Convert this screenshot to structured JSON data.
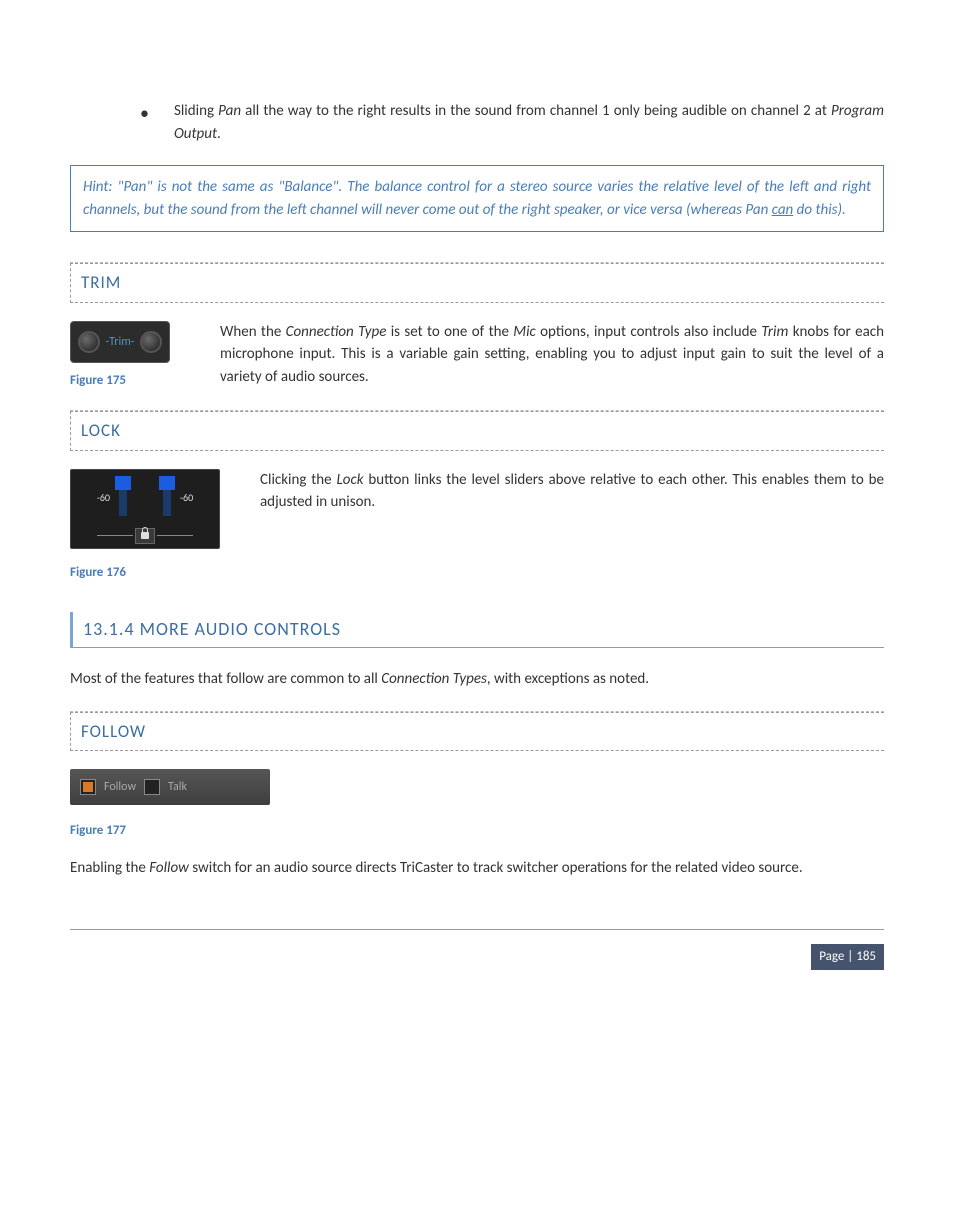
{
  "bullet": {
    "pre": "Sliding ",
    "em1": "Pan",
    "mid": " all the way to the right results in the sound from channel 1 only being audible on channel 2 at ",
    "em2": "Program Output",
    "post": "."
  },
  "hint": {
    "pre": "Hint: \"Pan\" is not the same as \"Balance\".  The balance control for a stereo source varies the relative level of the left and right channels, but the sound from the left channel will never come out of the right speaker, or vice versa (whereas Pan ",
    "underline": "can",
    "post": " do this)."
  },
  "trim": {
    "heading": "TRIM",
    "img_label": "-Trim-",
    "caption": "Figure 175",
    "text_pre": "When the ",
    "text_em1": "Connection Type",
    "text_mid1": " is set to one of the ",
    "text_em2": "Mic",
    "text_mid2": " options, input controls also include ",
    "text_em3": "Trim",
    "text_post": " knobs for each microphone input.  This is a variable gain setting, enabling you to adjust input gain to suit the level of a variety of audio sources."
  },
  "lock": {
    "heading": "LOCK",
    "level_left": "-60",
    "level_right": "-60",
    "caption": "Figure 176",
    "text_pre": "Clicking the ",
    "text_em": "Lock",
    "text_post": " button links the level sliders above relative to each other.  This enables them to be adjusted in unison."
  },
  "section": {
    "heading": "13.1.4 MORE AUDIO CONTROLS",
    "intro_pre": "Most of the features that follow are common to all ",
    "intro_em": "Connection Types",
    "intro_post": ", with exceptions as noted."
  },
  "follow": {
    "heading": "FOLLOW",
    "follow_label": "Follow",
    "talk_label": "Talk",
    "caption": "Figure 177",
    "para_pre": "Enabling the ",
    "para_em": "Follow",
    "para_post": " switch for an audio source directs TriCaster to track switcher operations for the related video source."
  },
  "footer": {
    "page": "Page | 185"
  }
}
